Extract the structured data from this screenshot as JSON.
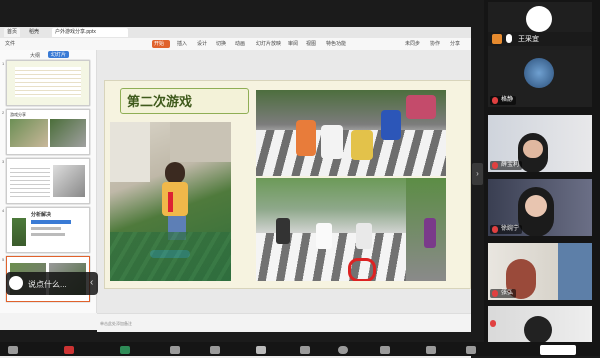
{
  "wps": {
    "tabs": [
      "首页",
      "稻壳",
      "户外游戏分享.pptx"
    ],
    "menu": [
      "文件",
      "开始",
      "插入",
      "设计",
      "切换",
      "动画",
      "幻灯片放映",
      "审阅",
      "视图",
      "特色功能"
    ],
    "menu_right": [
      "未同步",
      "协作",
      "分享"
    ],
    "thumb_tabs": [
      "大纲",
      "幻灯片"
    ]
  },
  "slide": {
    "title": "第二次游戏"
  },
  "thumbnails": [
    {
      "num": "1",
      "caption": ""
    },
    {
      "num": "2",
      "caption": "游戏分享"
    },
    {
      "num": "3",
      "caption": ""
    },
    {
      "num": "4",
      "caption": "分析解决"
    },
    {
      "num": "5",
      "caption": ""
    }
  ],
  "notes": {
    "placeholder": "单击此处添加备注"
  },
  "status": {
    "slide_count": "幻灯片 8 / 13",
    "theme": "Office 主题",
    "check": "文件检查",
    "zoom": "115 %",
    "note_btn": "一键美化"
  },
  "hint": {
    "text": "说点什么..."
  },
  "participants": [
    {
      "name": "王采宜",
      "muted": true
    },
    {
      "name": "格静",
      "muted": true
    },
    {
      "name": "薛宝利",
      "muted": true
    },
    {
      "name": "徐婉宁",
      "muted": true
    },
    {
      "name": "张弘",
      "muted": true
    },
    {
      "name": "",
      "muted": true
    }
  ],
  "colors": {
    "accent": "#e0622c",
    "slide_bg": "#f6f3e0",
    "title_green": "#3f5a1c"
  }
}
